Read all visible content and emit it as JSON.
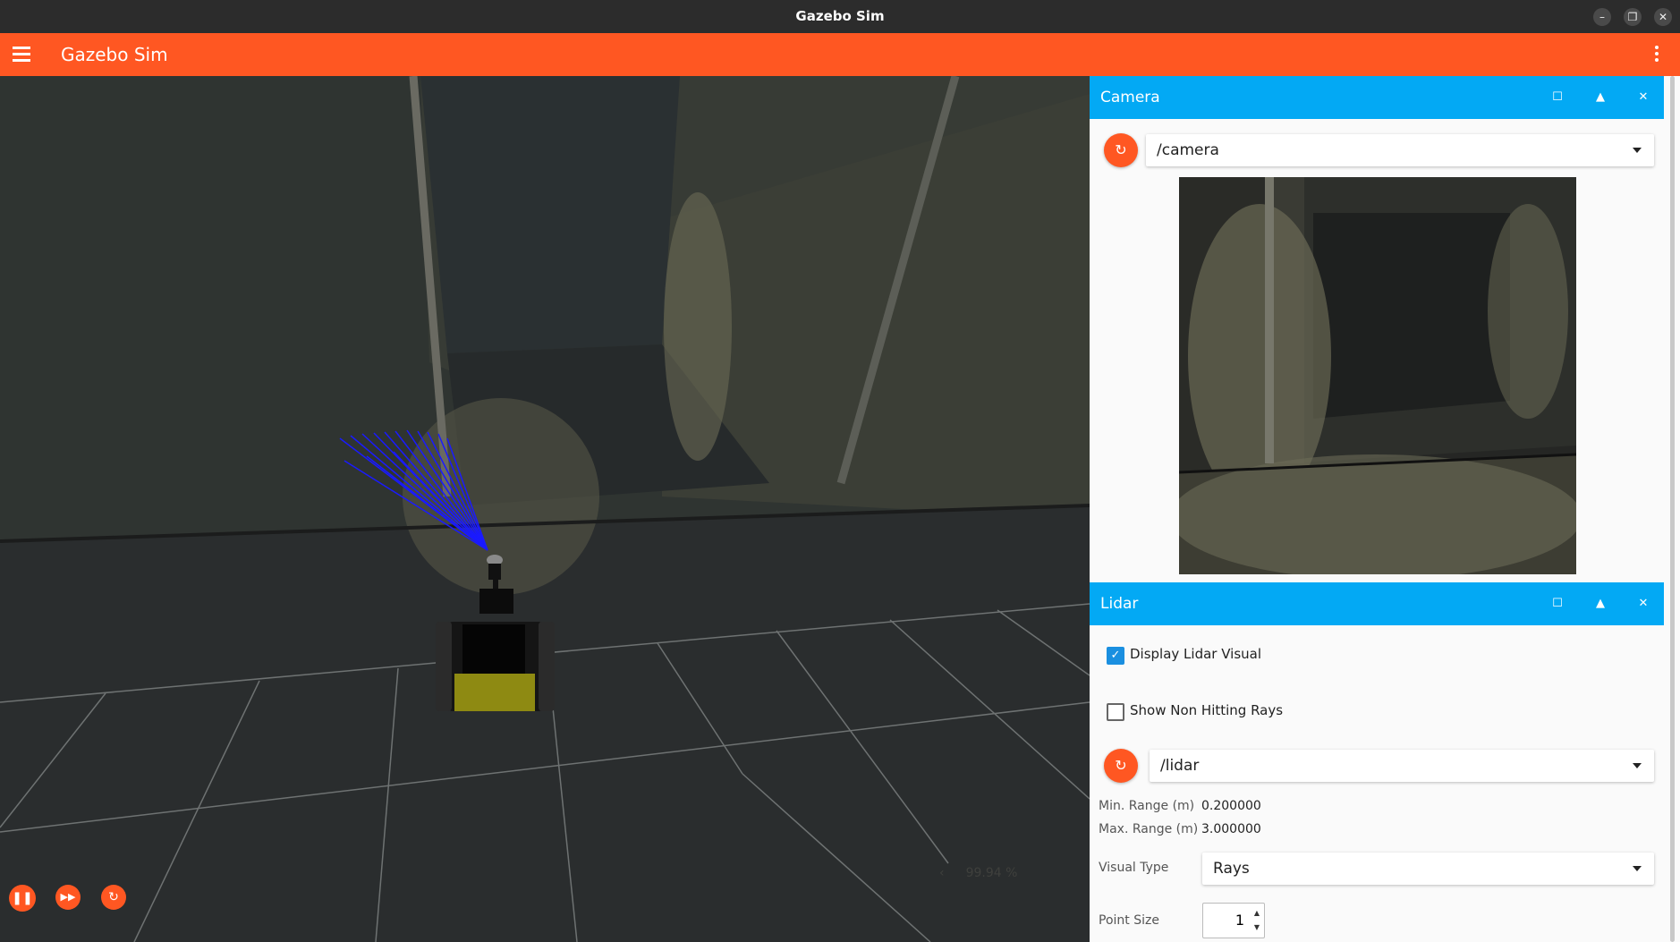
{
  "window": {
    "title": "Gazebo Sim"
  },
  "appbar": {
    "title": "Gazebo Sim"
  },
  "scene": {
    "real_time_factor": "99.94 %"
  },
  "camera_panel": {
    "title": "Camera",
    "topic": "/camera"
  },
  "lidar_panel": {
    "title": "Lidar",
    "display_lidar_visual": {
      "label": "Display Lidar Visual",
      "checked": true
    },
    "show_non_hitting_rays": {
      "label": "Show Non Hitting Rays",
      "checked": false
    },
    "topic": "/lidar",
    "min_range": {
      "label": "Min. Range (m)",
      "value": "0.200000"
    },
    "max_range": {
      "label": "Max. Range (m)",
      "value": "3.000000"
    },
    "visual_type": {
      "label": "Visual Type",
      "value": "Rays"
    },
    "point_size": {
      "label": "Point Size",
      "value": "1"
    }
  },
  "colors": {
    "accent": "#ff5722",
    "panel_header": "#03a9f4",
    "lidar_rays": "#1a1aff"
  },
  "icons": [
    "hamburger-icon",
    "kebab-icon",
    "minimize-icon",
    "restore-icon",
    "close-icon",
    "pause-icon",
    "step-icon",
    "reset-icon",
    "refresh-icon",
    "maximize-icon",
    "collapse-icon"
  ]
}
